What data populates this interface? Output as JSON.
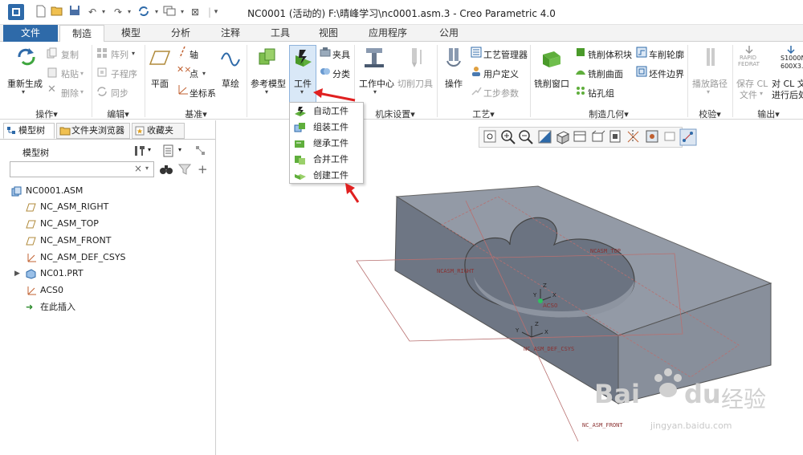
{
  "window": {
    "title": "NC0001 (活动的) F:\\晴峰学习\\nc0001.asm.3 - Creo Parametric 4.0"
  },
  "tabs": [
    {
      "label": "文件"
    },
    {
      "label": "制造"
    },
    {
      "label": "模型"
    },
    {
      "label": "分析"
    },
    {
      "label": "注释"
    },
    {
      "label": "工具"
    },
    {
      "label": "视图"
    },
    {
      "label": "应用程序"
    },
    {
      "label": "公用"
    }
  ],
  "ribbon": {
    "operations": {
      "group_label": "操作▾",
      "regenerate": "重新生成",
      "copy": "复制",
      "paste": "粘贴",
      "delete": "删除"
    },
    "edit": {
      "group_label": "编辑▾",
      "array": "阵列",
      "subprogram": "子程序",
      "sync": "同步"
    },
    "datum": {
      "group_label": "基准▾",
      "plane": "平面",
      "axis": "轴",
      "point": "点",
      "csys": "坐标系",
      "sketch": "草绘"
    },
    "components": {
      "ref_model": "参考模型",
      "workpiece": "工件",
      "fixture": "夹具",
      "classify": "分类"
    },
    "machine": {
      "group_label": "机床设置▾",
      "work_center": "工作中心",
      "cutting_tool": "切削刀具"
    },
    "process": {
      "group_label": "工艺▾",
      "operation": "操作",
      "process_manager": "工艺管理器",
      "user_defined": "用户定义",
      "step_params": "工步参数"
    },
    "mfg_geometry": {
      "group_label": "制造几何▾",
      "mill_window": "铣削窗口",
      "mill_volume": "铣削体积块",
      "mill_surface": "铣削曲面",
      "drill_group": "钻孔组",
      "turn_profile": "车削轮廓",
      "stock_boundary": "坯件边界"
    },
    "validate": {
      "group_label": "校验▾",
      "play_path": "播放路径"
    },
    "output": {
      "group_label": "输出▾",
      "rapid_top": "RAPID",
      "rapid_bottom": "FEDRAT",
      "save_cl": "保存 CL",
      "file": "文件",
      "s1000": "S1000N",
      "s600": "600X3.",
      "cl_post": "对 CL 文",
      "post_process": "进行后处"
    }
  },
  "dropdown": {
    "items": [
      {
        "label": "自动工件"
      },
      {
        "label": "组装工件"
      },
      {
        "label": "继承工件"
      },
      {
        "label": "合并工件"
      },
      {
        "label": "创建工件"
      }
    ]
  },
  "left_panel": {
    "tabs": [
      {
        "label": "模型树"
      },
      {
        "label": "文件夹浏览器"
      },
      {
        "label": "收藏夹"
      }
    ],
    "title": "模型树",
    "search_placeholder": "",
    "tree": [
      {
        "label": "NC0001.ASM"
      },
      {
        "label": "NC_ASM_RIGHT"
      },
      {
        "label": "NC_ASM_TOP"
      },
      {
        "label": "NC_ASM_FRONT"
      },
      {
        "label": "NC_ASM_DEF_CSYS"
      },
      {
        "label": "NC01.PRT"
      },
      {
        "label": "ACS0"
      },
      {
        "label": "在此插入"
      }
    ]
  },
  "viewport": {
    "label_top": "NCASM_TOP",
    "label_right": "NCASM_RIGHT",
    "label_front": "NC_ASM_FRONT",
    "label_acs": "ACS0",
    "label_defcsys": "NC_ASM_DEF_CSYS",
    "label_x": "X",
    "label_y": "Y",
    "label_z": "Z",
    "watermark_bai": "Bai",
    "watermark_du": "du",
    "watermark_jy": "经验",
    "watermark_url": "jingyan.baidu.com"
  },
  "colors": {
    "file_tab": "#2e6aa9",
    "part_fill": "#8f98a6",
    "red_arrow": "#e02020"
  }
}
